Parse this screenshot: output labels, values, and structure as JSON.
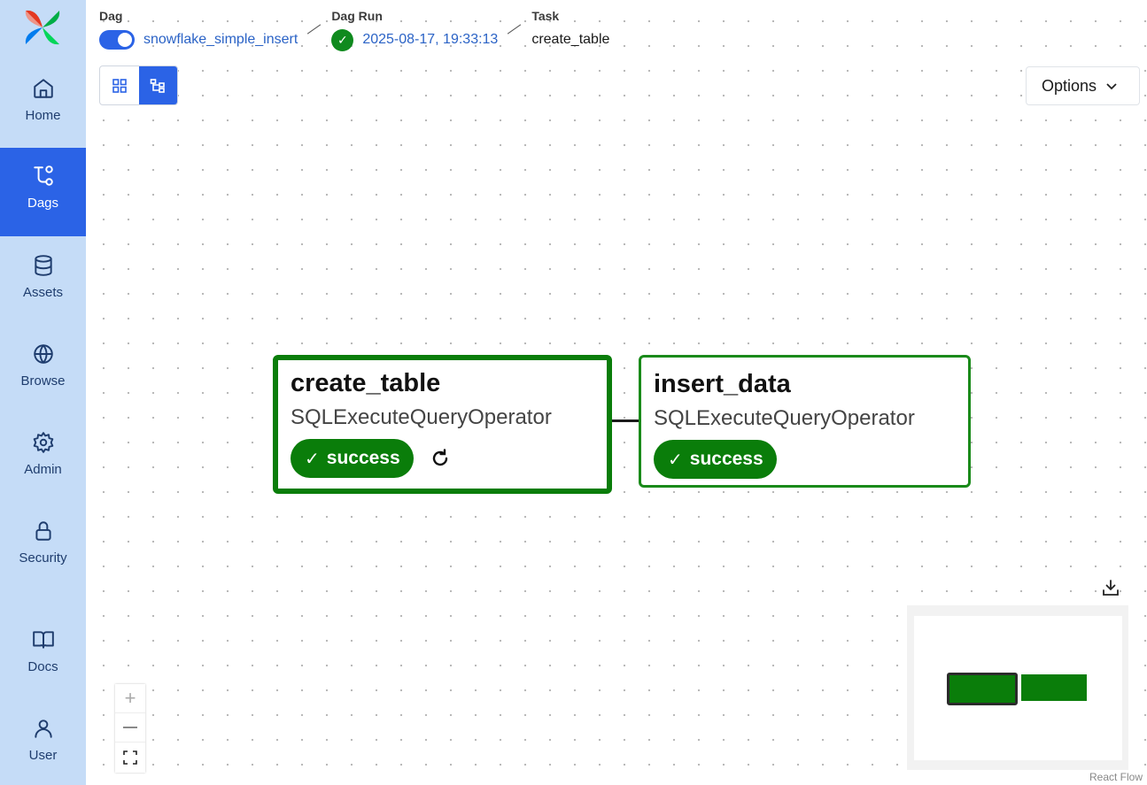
{
  "sidebar": {
    "items": [
      {
        "label": "Home",
        "icon": "home-icon"
      },
      {
        "label": "Dags",
        "icon": "dags-icon",
        "active": true
      },
      {
        "label": "Assets",
        "icon": "database-icon"
      },
      {
        "label": "Browse",
        "icon": "globe-icon"
      },
      {
        "label": "Admin",
        "icon": "gear-icon"
      },
      {
        "label": "Security",
        "icon": "lock-icon"
      },
      {
        "label": "Docs",
        "icon": "book-icon"
      },
      {
        "label": "User",
        "icon": "user-icon"
      }
    ]
  },
  "breadcrumb": {
    "dag": {
      "title": "Dag",
      "value": "snowflake_simple_insert",
      "enabled": true
    },
    "dag_run": {
      "title": "Dag Run",
      "value": "2025-08-17, 19:33:13",
      "status": "success"
    },
    "task": {
      "title": "Task",
      "value": "create_table"
    }
  },
  "toolbar": {
    "options_label": "Options",
    "view_modes": [
      "grid-view",
      "graph-view"
    ],
    "active_view": "graph-view"
  },
  "graph": {
    "nodes": [
      {
        "id": "create_table",
        "title": "create_table",
        "operator": "SQLExecuteQueryOperator",
        "status": "success",
        "selected": true
      },
      {
        "id": "insert_data",
        "title": "insert_data",
        "operator": "SQLExecuteQueryOperator",
        "status": "success",
        "selected": false
      }
    ],
    "edges": [
      [
        "create_table",
        "insert_data"
      ]
    ]
  },
  "zoom_controls": {
    "zoom_in": "+",
    "zoom_out": "—"
  },
  "attribution": "React Flow",
  "colors": {
    "sidebar_bg": "#c5dcf7",
    "accent": "#2b63e6",
    "success": "#0a7d0a",
    "link": "#2b63c6"
  }
}
